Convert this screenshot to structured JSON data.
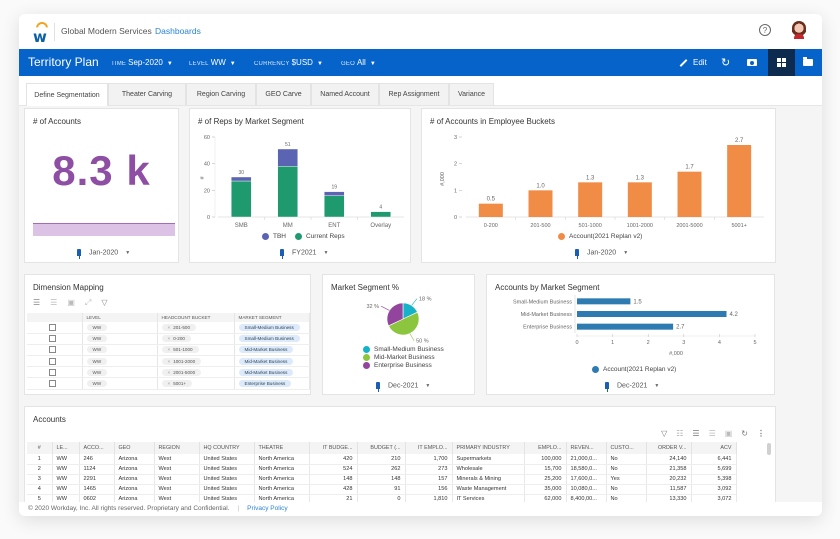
{
  "header": {
    "logo_letter": "w",
    "org_name": "Global Modern Services",
    "nav_link": "Dashboards",
    "help_symbol": "?"
  },
  "toolbar": {
    "title": "Territory Plan",
    "filters": [
      {
        "label": "TIME",
        "value": "Sep-2020"
      },
      {
        "label": "LEVEL",
        "value": "WW"
      },
      {
        "label": "CURRENCY",
        "value": "$USD"
      },
      {
        "label": "GEO",
        "value": "All"
      }
    ],
    "caret": "▼",
    "edit_label": "Edit",
    "refresh_symbol": "↻",
    "active_view": "grid"
  },
  "tabs": [
    {
      "label": "Define Segmentation",
      "active": true
    },
    {
      "label": "Theater Carving",
      "active": false
    },
    {
      "label": "Region Carving",
      "active": false
    },
    {
      "label": "GEO Carve",
      "active": false
    },
    {
      "label": "Named Account",
      "active": false
    },
    {
      "label": "Rep Assignment",
      "active": false
    },
    {
      "label": "Variance",
      "active": false
    }
  ],
  "cards": {
    "accounts": {
      "title": "# of Accounts",
      "value": "8.3 k",
      "date": "Jan-2020",
      "color": "#8e4ea4"
    },
    "reps": {
      "title": "# of Reps by Market Segment",
      "date": "FY2021"
    },
    "employee_buckets": {
      "title": "# of Accounts in Employee Buckets",
      "date": "Jan-2020"
    },
    "dimension_mapping": {
      "title": "Dimension Mapping",
      "columns": [
        "",
        "LEVEL",
        "HEADCOUNT BUCKET",
        "MARKET SEGMENT"
      ],
      "rows": [
        {
          "level": "WW",
          "bucket": "201-500",
          "segment": "Small-Medium Business"
        },
        {
          "level": "WW",
          "bucket": "0-200",
          "segment": "Small-Medium Business"
        },
        {
          "level": "WW",
          "bucket": "501-1000",
          "segment": "Mid-Market Business"
        },
        {
          "level": "WW",
          "bucket": "1001-2000",
          "segment": "Mid-Market Business"
        },
        {
          "level": "WW",
          "bucket": "2001-5000",
          "segment": "Mid-Market Business"
        },
        {
          "level": "WW",
          "bucket": "5001+",
          "segment": "Enterprise Business"
        }
      ]
    },
    "market_segment_pct": {
      "title": "Market Segment %",
      "date": "Dec-2021"
    },
    "accounts_by_segment": {
      "title": "Accounts by Market Segment",
      "date": "Dec-2021"
    },
    "accounts_table": {
      "title": "Accounts",
      "columns": [
        "#",
        "LE...",
        "ACCO...",
        "GEO",
        "REGION",
        "HQ COUNTRY",
        "THEATRE",
        "IT BUDGE...",
        "BUDGET (...",
        "IT EMPLO...",
        "PRIMARY INDUSTRY",
        "EMPLO...",
        "REVEN...",
        "CUSTO...",
        "ORDER V...",
        "ACV"
      ],
      "rows": [
        [
          "1",
          "WW",
          "246",
          "Arizona",
          "West",
          "United States",
          "North America",
          "420",
          "210",
          "1,700",
          "Supermarkets",
          "100,000",
          "21,000,0...",
          "No",
          "24,140",
          "6,441"
        ],
        [
          "2",
          "WW",
          "1124",
          "Arizona",
          "West",
          "United States",
          "North America",
          "524",
          "262",
          "273",
          "Wholesale",
          "15,700",
          "18,580,0...",
          "No",
          "21,358",
          "5,699"
        ],
        [
          "3",
          "WW",
          "2291",
          "Arizona",
          "West",
          "United States",
          "North America",
          "148",
          "148",
          "157",
          "Minerals & Mining",
          "25,200",
          "17,600,0...",
          "Yes",
          "20,232",
          "5,398"
        ],
        [
          "4",
          "WW",
          "1465",
          "Arizona",
          "West",
          "United States",
          "North America",
          "428",
          "91",
          "156",
          "Waste Management",
          "35,000",
          "10,080,0...",
          "No",
          "11,587",
          "3,092"
        ],
        [
          "5",
          "WW",
          "0602",
          "Arizona",
          "West",
          "United States",
          "North America",
          "21",
          "0",
          "1,810",
          "IT Services",
          "62,000",
          "8,400,00...",
          "No",
          "13,330",
          "3,072"
        ]
      ]
    }
  },
  "chart_data": [
    {
      "type": "bar",
      "stacked": true,
      "title": "# of Reps by Market Segment",
      "categories": [
        "SMB",
        "MM",
        "ENT",
        "Overlay"
      ],
      "series": [
        {
          "name": "Current Reps",
          "color": "#1f9a6e",
          "values": [
            27,
            38,
            16,
            4
          ]
        },
        {
          "name": "TBH",
          "color": "#5b63b3",
          "values": [
            3,
            13,
            3,
            0
          ]
        }
      ],
      "totals": [
        30,
        51,
        19,
        4
      ],
      "ylabel": "#",
      "ylim": [
        0,
        60
      ],
      "yticks": [
        0,
        20,
        40,
        60
      ],
      "legend": "bottom"
    },
    {
      "type": "bar",
      "title": "# of Accounts in Employee Buckets",
      "categories": [
        "0-200",
        "201-500",
        "501-1000",
        "1001-2000",
        "2001-5000",
        "5001+"
      ],
      "values": [
        0.5,
        1.0,
        1.3,
        1.3,
        1.7,
        2.7
      ],
      "labels": [
        "0.5",
        "1.0",
        "1.3",
        "1.3",
        "1.7",
        "2.7"
      ],
      "series_name": "Account(2021 Replan v2)",
      "color": "#f08c46",
      "ylabel": "#,000",
      "ylim": [
        0,
        3
      ],
      "yticks": [
        0,
        1,
        2,
        3
      ],
      "legend": "bottom"
    },
    {
      "type": "pie",
      "title": "Market Segment %",
      "slices": [
        {
          "label": "Small-Medium Business",
          "value": 18,
          "text": "18 %",
          "color": "#16b2c8"
        },
        {
          "label": "Mid-Market Business",
          "value": 50,
          "text": "50 %",
          "color": "#8cc63e"
        },
        {
          "label": "Enterprise Business",
          "value": 32,
          "text": "32 %",
          "color": "#93459e"
        }
      ],
      "legend": "bottom"
    },
    {
      "type": "bar",
      "orientation": "horizontal",
      "title": "Accounts by Market Segment",
      "categories": [
        "Small-Medium Business",
        "Mid-Market Business",
        "Enterprise Business"
      ],
      "values": [
        1.5,
        4.2,
        2.7
      ],
      "series_name": "Account(2021 Replan v2)",
      "color": "#2d7bb0",
      "xlabel": "#,000",
      "xlim": [
        0,
        5
      ],
      "xticks": [
        0,
        1,
        2,
        3,
        4,
        5
      ],
      "legend": "bottom"
    }
  ],
  "footer": {
    "copyright": "© 2020 Workday, Inc. All rights reserved. Proprietary and Confidential.",
    "separator": "|",
    "privacy_link": "Privacy Policy"
  }
}
